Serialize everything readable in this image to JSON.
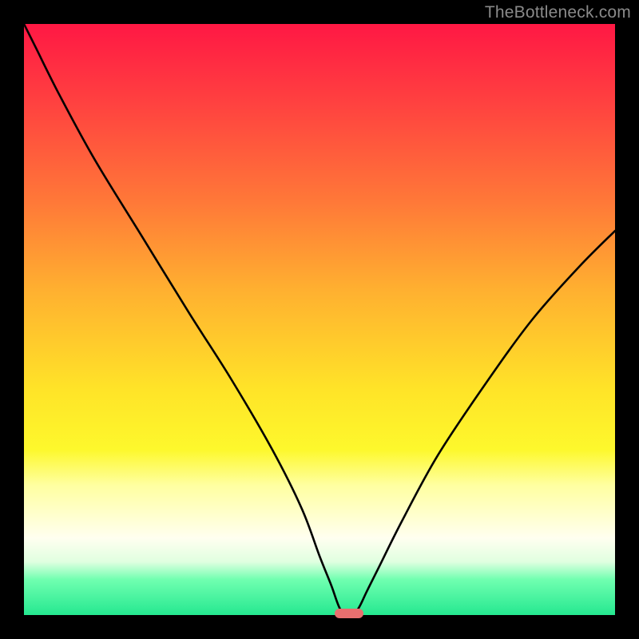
{
  "watermark": "TheBottleneck.com",
  "chart_data": {
    "type": "line",
    "title": "",
    "xlabel": "",
    "ylabel": "",
    "xlim": [
      0,
      100
    ],
    "ylim": [
      0,
      100
    ],
    "x": [
      0,
      2,
      6,
      12,
      20,
      28,
      35,
      42,
      47,
      50,
      52,
      53.5,
      55,
      56.5,
      58,
      60,
      64,
      70,
      78,
      86,
      94,
      100
    ],
    "y": [
      100,
      96,
      88,
      77,
      64,
      51,
      40,
      28,
      18,
      10,
      5,
      1,
      0,
      1,
      4,
      8,
      16,
      27,
      39,
      50,
      59,
      65
    ],
    "marker": {
      "x": 55,
      "y": 0
    },
    "background_gradient": {
      "stops": [
        {
          "pos": 0,
          "color": "#ff1844"
        },
        {
          "pos": 13,
          "color": "#ff4040"
        },
        {
          "pos": 30,
          "color": "#ff7838"
        },
        {
          "pos": 45,
          "color": "#ffb030"
        },
        {
          "pos": 62,
          "color": "#ffe428"
        },
        {
          "pos": 72,
          "color": "#fdf82c"
        },
        {
          "pos": 78,
          "color": "#ffffa0"
        },
        {
          "pos": 87,
          "color": "#fffff0"
        },
        {
          "pos": 91,
          "color": "#e0ffe0"
        },
        {
          "pos": 94,
          "color": "#70ffb0"
        },
        {
          "pos": 100,
          "color": "#25e890"
        }
      ]
    }
  }
}
